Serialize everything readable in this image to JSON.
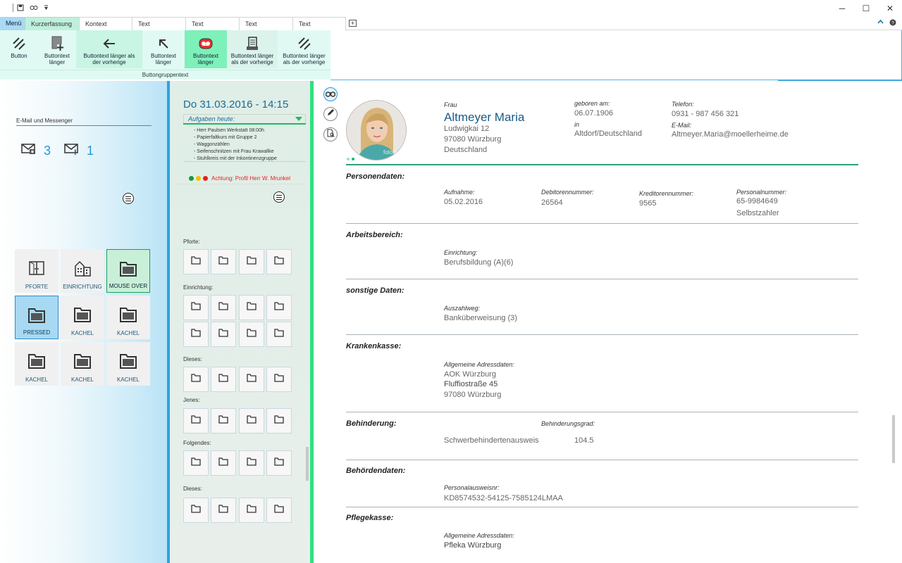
{
  "quick_access": {
    "items": [
      "save-icon",
      "link-icon",
      "dropdown-icon"
    ]
  },
  "window_controls": {
    "minimize": "─",
    "maximize": "☐",
    "close": "✕"
  },
  "tabs": [
    {
      "label": "Menü"
    },
    {
      "label": "Kurzerfassung"
    },
    {
      "label": "Kontext"
    },
    {
      "label": "Text"
    },
    {
      "label": "Text"
    },
    {
      "label": "Text"
    },
    {
      "label": "Text"
    }
  ],
  "ribbon": {
    "buttons": [
      {
        "label": "Button",
        "icon": "hatch-icon"
      },
      {
        "label": "Buttontext länger",
        "icon": "page-add-icon"
      },
      {
        "label": "Buttontext länger als der vorherige",
        "icon": "arrow-left-icon"
      },
      {
        "label": "Buttontext länger",
        "icon": "arrow-up-left-icon"
      },
      {
        "label": "Buttontext länger",
        "icon": "record-icon"
      },
      {
        "label": "Buttontext länger als der vorherige",
        "icon": "document-icon"
      },
      {
        "label": "Buttontext länger als der vorherige",
        "icon": "hatch-icon"
      }
    ],
    "group_label": "Buttongruppentext"
  },
  "left": {
    "email_label": "E-Mail und Messenger",
    "mail_count": "3",
    "message_count": "1",
    "tiles": [
      {
        "label": "PFORTE",
        "icon": "door-icon"
      },
      {
        "label": "EINRICHTUNG",
        "icon": "building-icon"
      },
      {
        "label": "MOUSE OVER",
        "icon": "folder-icon"
      },
      {
        "label": "PRESSED",
        "icon": "folder-icon"
      },
      {
        "label": "KACHEL",
        "icon": "folder-icon"
      },
      {
        "label": "KACHEL",
        "icon": "folder-icon"
      },
      {
        "label": "KACHEL",
        "icon": "folder-icon"
      },
      {
        "label": "KACHEL",
        "icon": "folder-icon"
      },
      {
        "label": "KACHEL",
        "icon": "folder-icon"
      }
    ]
  },
  "middle": {
    "date_title": "Do 31.03.2016 - 14:15",
    "tasks_heading": "Aufgaben heute:",
    "tasks": [
      "- Herr Paulsen Werkstatt 08:00h",
      "- Papierfaltkurs mit Gruppe 2",
      "- Waggonzählen",
      "- Seifenschnitzen mit Frau Krawallke",
      "- Stuhlkreis mit der Inkontinenzgruppe"
    ],
    "alert_text": "Achtung: Profil Herr W. Mrunkel",
    "alert_colors": [
      "#1a9a3a",
      "#f2c200",
      "#e0231d"
    ],
    "sections": [
      "Pforte:",
      "Einrichtung:",
      "Dieses:",
      "Jenes:",
      "Folgendes:",
      "Dieses:"
    ]
  },
  "person": {
    "salutation": "Frau",
    "name": "Altmeyer Maria",
    "street": "Ludwigkai 12",
    "city": "97080 Würzburg",
    "country": "Deutschland",
    "born_label": "geboren am:",
    "born_date": "06.07.1906",
    "born_in_label": "in",
    "born_place": "Altdorf/Deutschland",
    "phone_label": "Telefon:",
    "phone": "0931 - 987 456 321",
    "email_label": "E-Mail:",
    "email": "Altmeyer.Maria@moellerheime.de",
    "photo_watermark": "fotolia"
  },
  "sections": {
    "personendaten": {
      "title": "Personendaten:",
      "aufnahme_label": "Aufnahme:",
      "aufnahme": "05.02.2016",
      "debitor_label": "Debitorennummer:",
      "debitor": "26564",
      "kreditor_label": "Kreditorennummer:",
      "kreditor": "9565",
      "personal_label": "Personalnummer:",
      "personal": "65-9984649",
      "personal_extra": "Selbstzahler"
    },
    "arbeitsbereich": {
      "title": "Arbeitsbereich:",
      "einrichtung_label": "Einrichtung:",
      "einrichtung": "Berufsbildung (A)(6)"
    },
    "sonstige": {
      "title": "sonstige Daten:",
      "auszahlweg_label": "Auszahlweg:",
      "auszahlweg": "Banküberweisung (3)"
    },
    "krankenkasse": {
      "title": "Krankenkasse:",
      "adress_label": "Allgemeine Adressdaten:",
      "name": "AOK Würzburg",
      "street": "Fluffiostraße 45",
      "city": "97080 Würzburg"
    },
    "behinderung": {
      "title": "Behinderung:",
      "grad_label": "Behinderungsgrad:",
      "type": "Schwerbehindertenausweis",
      "grad": "104.5"
    },
    "behoerden": {
      "title": "Behördendaten:",
      "ausweis_label": "Personalausweisnr:",
      "ausweis": "KD8574532-54125-7585124LMAA"
    },
    "pflegekasse": {
      "title": "Pflegekasse:",
      "adress_label": "Allgemeine Adressdaten:",
      "name": "Pfleka Würzburg"
    }
  }
}
